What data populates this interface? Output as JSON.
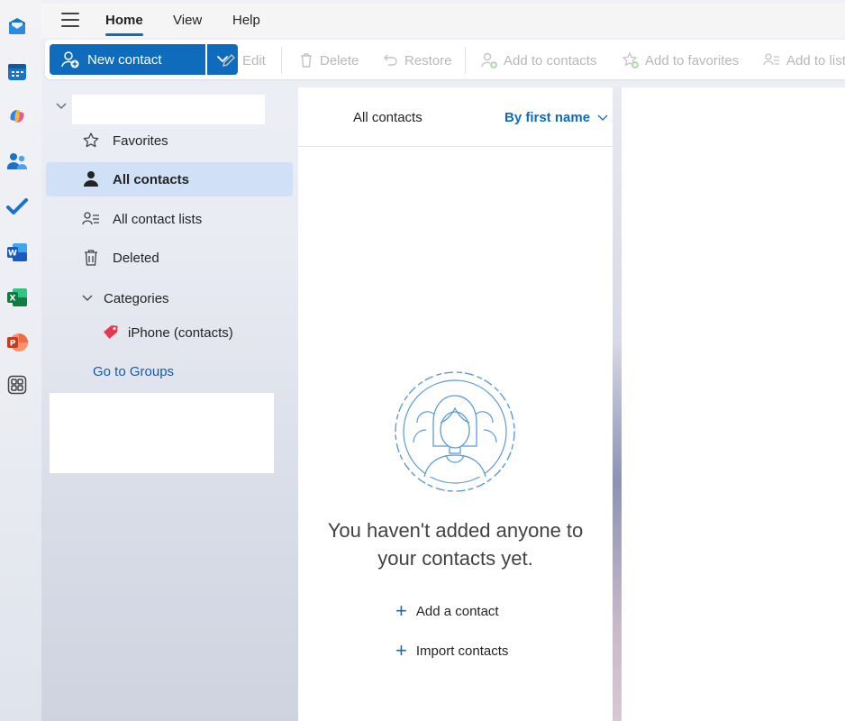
{
  "app": {
    "rail": [
      "outlook-mail-icon",
      "calendar-icon",
      "copilot-icon",
      "people-icon",
      "todo-icon",
      "word-icon",
      "excel-icon",
      "powerpoint-icon",
      "apps-icon"
    ]
  },
  "menubar": {
    "tabs": [
      {
        "label": "Home",
        "active": true
      },
      {
        "label": "View",
        "active": false
      },
      {
        "label": "Help",
        "active": false
      }
    ]
  },
  "toolbar": {
    "new_contact": "New contact",
    "edit": "Edit",
    "delete": "Delete",
    "restore": "Restore",
    "add_to_contacts": "Add to contacts",
    "add_to_favorites": "Add to favorites",
    "add_to_list": "Add to list"
  },
  "nav": {
    "account_name": "",
    "items": [
      {
        "label": "Favorites",
        "icon": "star-icon",
        "selected": false
      },
      {
        "label": "All contacts",
        "icon": "person-icon",
        "selected": true
      },
      {
        "label": "All contact lists",
        "icon": "contact-list-icon",
        "selected": false
      },
      {
        "label": "Deleted",
        "icon": "trash-icon",
        "selected": false
      }
    ],
    "categories_label": "Categories",
    "category_items": [
      {
        "label": "iPhone (contacts)",
        "icon": "tag-icon",
        "color": "#e8384f"
      }
    ],
    "go_to_groups": "Go to Groups"
  },
  "list": {
    "title": "All contacts",
    "sort_label": "By first name",
    "empty_message_line1": "You haven't added anyone to",
    "empty_message_line2": "your contacts yet.",
    "add_contact": "Add a contact",
    "import_contacts": "Import contacts"
  },
  "colors": {
    "accent": "#0f6cbd",
    "selected_bg": "#cfe0f7",
    "link": "#115ea3"
  }
}
